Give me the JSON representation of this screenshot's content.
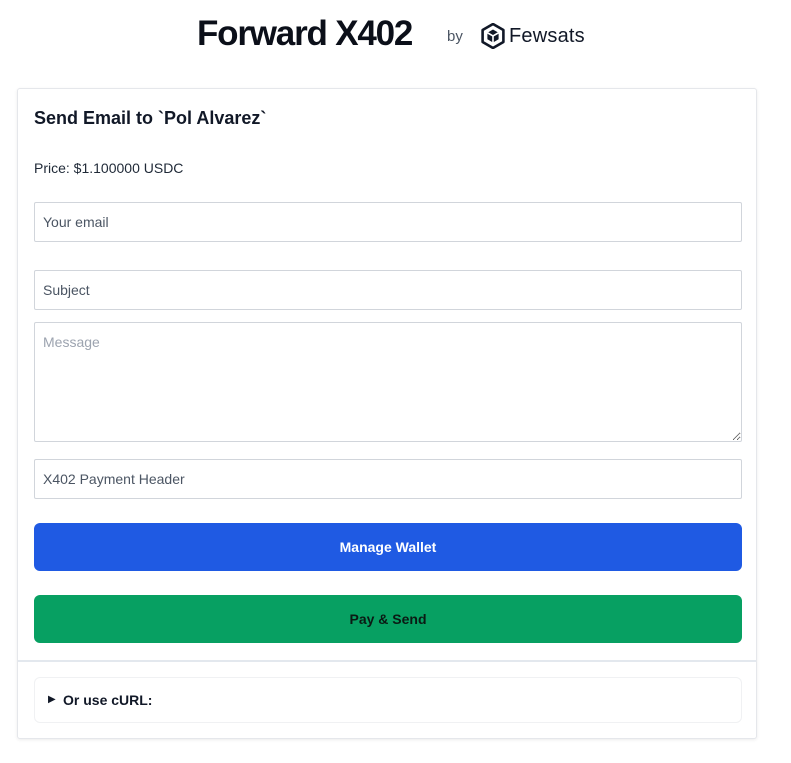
{
  "header": {
    "title": "Forward X402",
    "by": "by",
    "brand_name": "Fewsats",
    "brand_icon": "fewsats-logo-icon"
  },
  "form": {
    "title": "Send Email to `Pol Alvarez`",
    "price": "Price: $1.100000 USDC",
    "email_placeholder": "Your email",
    "subject_placeholder": "Subject",
    "message_placeholder": "Message",
    "payment_header_placeholder": "X402 Payment Header",
    "manage_wallet_label": "Manage Wallet",
    "pay_send_label": "Pay & Send"
  },
  "curl": {
    "marker": "▶",
    "summary": "Or use cURL:"
  },
  "colors": {
    "manage_wallet": "#1f5ae3",
    "pay_send": "#07a062"
  }
}
